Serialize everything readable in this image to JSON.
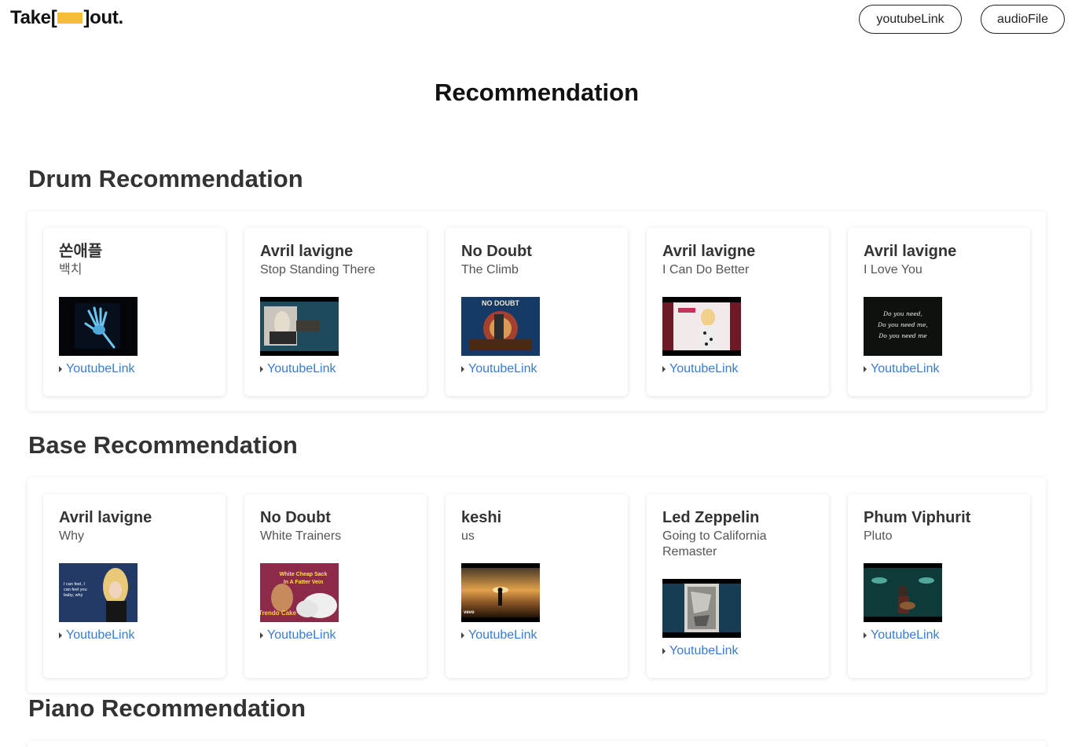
{
  "header": {
    "logo_left": "Take[",
    "logo_right": "]out.",
    "nav": {
      "youtube_label": "youtubeLink",
      "audio_label": "audioFile"
    }
  },
  "page_title": "Recommendation",
  "sections": [
    {
      "title": "Drum Recommendation",
      "cards": [
        {
          "artist": "쏜애플",
          "song": "백치",
          "link_label": "YoutubeLink"
        },
        {
          "artist": "Avril lavigne",
          "song": "Stop Standing There",
          "link_label": "YoutubeLink"
        },
        {
          "artist": "No Doubt",
          "song": "The Climb",
          "link_label": "YoutubeLink"
        },
        {
          "artist": "Avril lavigne",
          "song": "I Can Do Better",
          "link_label": "YoutubeLink"
        },
        {
          "artist": "Avril lavigne",
          "song": "I Love You",
          "link_label": "YoutubeLink"
        }
      ]
    },
    {
      "title": "Base Recommendation",
      "cards": [
        {
          "artist": "Avril lavigne",
          "song": "Why",
          "link_label": "YoutubeLink"
        },
        {
          "artist": "No Doubt",
          "song": "White Trainers",
          "link_label": "YoutubeLink"
        },
        {
          "artist": "keshi",
          "song": "us",
          "link_label": "YoutubeLink"
        },
        {
          "artist": "Led Zeppelin",
          "song": "Going to California Remaster",
          "link_label": "YoutubeLink"
        },
        {
          "artist": "Phum Viphurit",
          "song": "Pluto",
          "link_label": "YoutubeLink"
        }
      ]
    },
    {
      "title": "Piano Recommendation",
      "cards": []
    }
  ],
  "thumb_text": {
    "nodoubt_cover": "NO DOUBT",
    "iloveyou_lines": [
      "Do you need,",
      "Do you need me,",
      "Do you need me"
    ],
    "why_lines": [
      "I can feel, I",
      "can feel you",
      "baby, why"
    ],
    "trainers_lines": [
      "White Cheap Sack",
      "In A Fatter Vein",
      "Trendo Cake"
    ],
    "vevo": "vevo"
  },
  "colors": {
    "logo_blank": "#f5bd36",
    "link": "#3a7bd5"
  }
}
